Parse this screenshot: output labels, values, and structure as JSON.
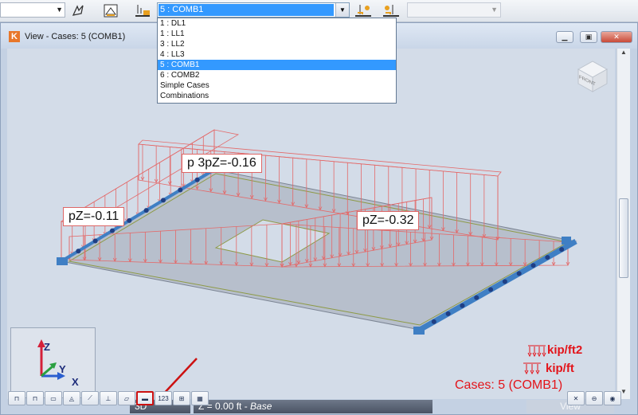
{
  "toolbar": {
    "case_combo": {
      "selected": "5 : COMB1",
      "options": [
        "1 : DL1",
        "1 : LL1",
        "3 : LL2",
        "4 : LL3",
        "5 : COMB1",
        "6 : COMB2",
        "Simple Cases",
        "Combinations"
      ]
    }
  },
  "window": {
    "title": "View - Cases: 5 (COMB1)"
  },
  "viewcube": {
    "label": "FRONT"
  },
  "loads": {
    "label_left": "pZ=-0.11",
    "label_top": "p 3pZ=-0.16",
    "label_right": "pZ=-0.32"
  },
  "legend": {
    "area_unit": "kip/ft2",
    "line_unit": "kip/ft",
    "cases": "Cases: 5 (COMB1)"
  },
  "axes": {
    "z": "Z",
    "y": "Y",
    "x": "X"
  },
  "status": {
    "view_mode": "3D",
    "z_prefix": "Z = 0.00 ft - ",
    "z_level": "Base",
    "right_tab": "View"
  },
  "colors": {
    "load_red": "#e3141a",
    "selection_blue": "#3399ff",
    "slab_grey": "#b7bfcc",
    "support_blue": "#3f7fc4"
  }
}
